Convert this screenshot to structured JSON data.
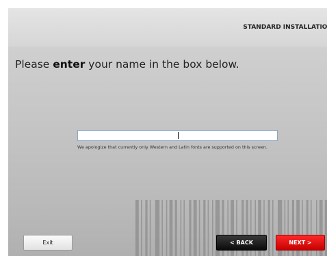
{
  "header": {
    "title": "STANDARD INSTALLATION"
  },
  "instruction": {
    "prefix": "Please ",
    "emphasis": "enter",
    "suffix": " your name in the box below."
  },
  "name_field": {
    "value": "",
    "placeholder": ""
  },
  "notice": {
    "text": "We apologize that currently only Western and Latin fonts are supported on this screen."
  },
  "buttons": {
    "exit": "Exit",
    "back": "< BACK",
    "next": "NEXT >"
  },
  "colors": {
    "next_button": "#e00000",
    "back_button": "#111111",
    "input_border": "#8aa6c8"
  },
  "decorations": {
    "background_graphic": "barcode-graphic"
  }
}
